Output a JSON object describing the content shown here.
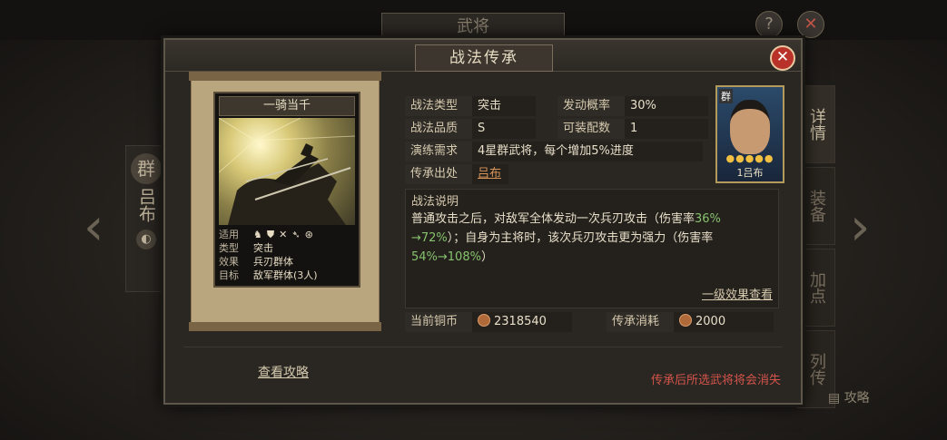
{
  "background": {
    "tab_title": "武将",
    "help_icon": "?",
    "close_icon": "✕",
    "hero_faction": "群",
    "hero_name": "吕布",
    "side_tabs": [
      "详情",
      "装备",
      "加点",
      "列传"
    ],
    "strategy_link": "攻略"
  },
  "modal": {
    "title": "战法传承",
    "close_glyph": "✕"
  },
  "card": {
    "name": "一骑当千",
    "suit_label": "适用",
    "suit_icons": [
      "cavalry-icon",
      "shield-icon",
      "bow-icon",
      "spear-icon",
      "siege-icon"
    ],
    "suit_glyphs": [
      "♞",
      "⛊",
      "✕",
      "➴",
      "⊛"
    ],
    "type_label": "类型",
    "type_value": "突击",
    "effect_label": "效果",
    "effect_value": "兵刃群体",
    "target_label": "目标",
    "target_value": "敌军群体(3人)"
  },
  "info": {
    "type_label": "战法类型",
    "type_value": "突击",
    "rate_label": "发动概率",
    "rate_value": "30%",
    "quality_label": "战法品质",
    "quality_value": "S",
    "slots_label": "可装配数",
    "slots_value": "1",
    "req_label": "演练需求",
    "req_value": "4星群武将，每个增加5%进度",
    "source_label": "传承出处",
    "source_value": "吕布"
  },
  "portrait": {
    "faction": "群",
    "stars": "●●●●●",
    "name": "1吕布"
  },
  "description": {
    "title": "战法说明",
    "line1_a": "普通攻击之后，对敌军全体发动一次兵刃攻击（伤害率",
    "line1_num": "36%",
    "line2_num": "→72%",
    "line2_b": "）；自身为主将时，该次兵刃攻击更为强力（伤害率",
    "line3_num": "54%→108%",
    "line3_b": "）",
    "level_link": "一级效果查看"
  },
  "cost": {
    "coins_label": "当前铜币",
    "coins_value": "2318540",
    "cost_label": "传承消耗",
    "cost_value": "2000"
  },
  "footer": {
    "guide_link": "查看攻略",
    "warning": "传承后所选武将将会消失"
  },
  "colors": {
    "accent_red": "#d3544a",
    "highlight_green": "#86c26d",
    "link_orange": "#d99458"
  }
}
